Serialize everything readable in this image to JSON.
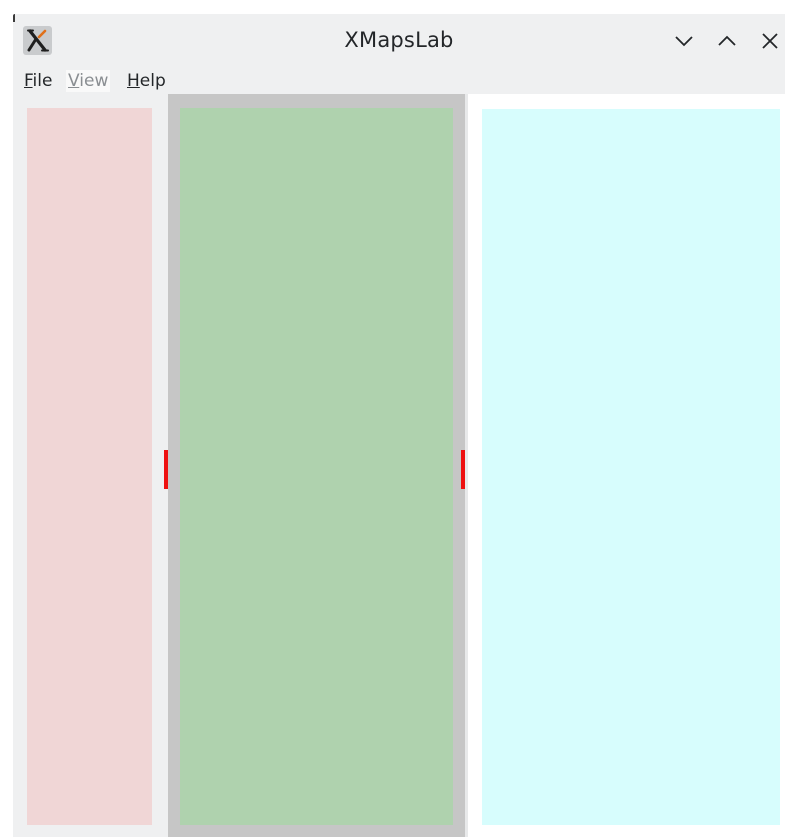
{
  "window": {
    "title": "XMapsLab",
    "app_icon": "xmapslab-x-icon",
    "controls": [
      "minimize-icon",
      "maximize-icon",
      "close-icon"
    ]
  },
  "menu": {
    "items": [
      {
        "label": "File",
        "mnemonic": "F",
        "rest": "ile",
        "enabled": true
      },
      {
        "label": "View",
        "mnemonic": "V",
        "rest": "iew",
        "enabled": false
      },
      {
        "label": "Help",
        "mnemonic": "H",
        "rest": "elp",
        "enabled": true
      }
    ]
  },
  "panels": {
    "left_color": "#f0d6d6",
    "middle_color": "#afd2ae",
    "right_color": "#d7fdfd",
    "splitter_handle_color": "#ee1111"
  }
}
